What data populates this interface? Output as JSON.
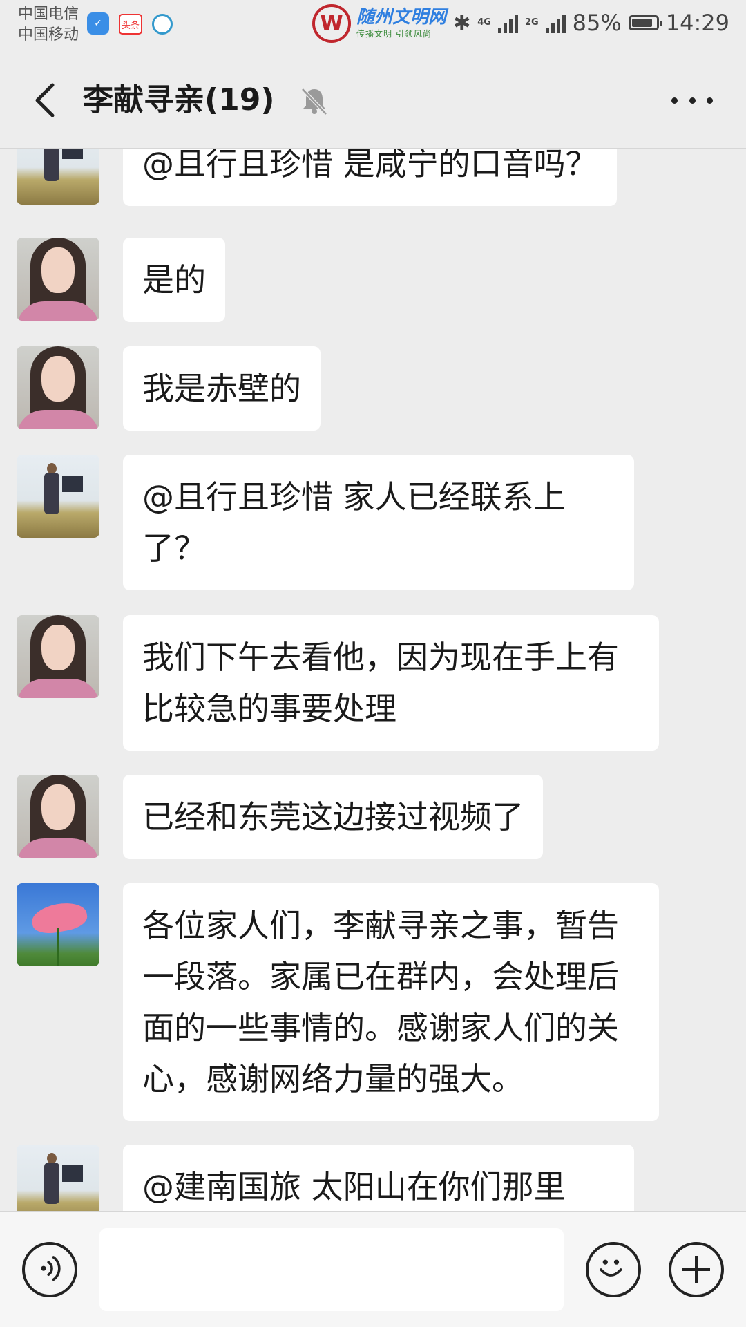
{
  "status_bar": {
    "carrier_1": "中国电信",
    "carrier_2": "中国移动",
    "toutiao": "头条",
    "watermark_title": "随州文明网",
    "watermark_subtitle": "传播文明  引领风尚",
    "net_4g": "4G",
    "net_2g": "2G",
    "battery": "85%",
    "time": "14:29",
    "battery_level": 0.85
  },
  "header": {
    "title": "李献寻亲(19)",
    "icons": [
      "back-arrow-icon",
      "mute-bell-icon",
      "more-dots-icon"
    ]
  },
  "messages": [
    {
      "avatar": "man-mountain",
      "text": "@且行且珍惜  是咸宁的口音吗？"
    },
    {
      "avatar": "woman",
      "text": "是的"
    },
    {
      "avatar": "woman",
      "text": "我是赤壁的"
    },
    {
      "avatar": "man-mountain",
      "text": "@且行且珍惜  家人已经联系上了？"
    },
    {
      "avatar": "woman",
      "text": "我们下午去看他，因为现在手上有比较急的事要处理"
    },
    {
      "avatar": "woman",
      "text": "已经和东莞这边接过视频了"
    },
    {
      "avatar": "lotus",
      "text": "各位家人们，李献寻亲之事，暂告一段落。家属已在群内，会处理后面的一些事情的。感谢家人们的关心，感谢网络力量的强大。"
    },
    {
      "avatar": "man-mountain",
      "text": "@建南国旅  太阳山在你们那里"
    }
  ],
  "input_bar": {
    "value": "",
    "icons": [
      "voice-icon",
      "emoji-icon",
      "plus-icon"
    ]
  }
}
